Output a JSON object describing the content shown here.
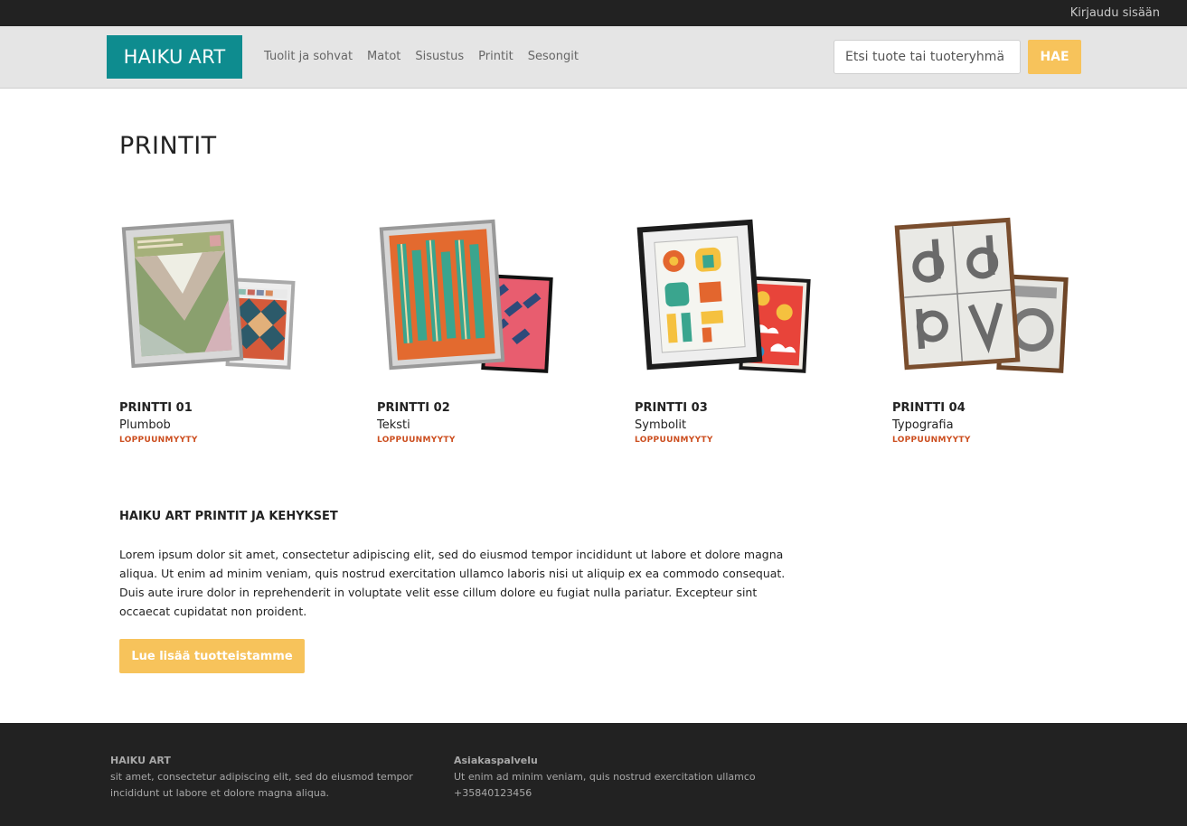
{
  "topbar": {
    "login": "Kirjaudu sisään"
  },
  "header": {
    "logo_bold": "HAIKU",
    "logo_light": "ART",
    "nav": [
      "Tuolit ja sohvat",
      "Matot",
      "Sisustus",
      "Printit",
      "Sesongit"
    ],
    "search_placeholder": "Etsi tuote tai tuoteryhmä",
    "search_button": "HAE"
  },
  "main": {
    "title": "PRINTIT",
    "products": [
      {
        "name": "PRINTTI 01",
        "subtitle": "Plumbob",
        "status": "LOPPUUNMYYTY",
        "frame_color": "#c9c9c9"
      },
      {
        "name": "PRINTTI 02",
        "subtitle": "Teksti",
        "status": "LOPPUUNMYYTY",
        "frame_color": "#c9c9c9"
      },
      {
        "name": "PRINTTI 03",
        "subtitle": "Symbolit",
        "status": "LOPPUUNMYYTY",
        "frame_color": "#222222"
      },
      {
        "name": "PRINTTI 04",
        "subtitle": "Typografia",
        "status": "LOPPUUNMYYTY",
        "frame_color": "#7a4e2e"
      }
    ],
    "section_heading": "HAIKU ART PRINTIT JA KEHYKSET",
    "section_body": "Lorem ipsum dolor sit amet, consectetur adipiscing elit, sed do eiusmod tempor incididunt ut labore et dolore magna aliqua. Ut enim ad minim veniam, quis nostrud exercitation ullamco laboris nisi ut aliquip ex ea commodo consequat. Duis aute irure dolor in reprehenderit in voluptate velit esse cillum dolore eu fugiat nulla pariatur. Excepteur sint occaecat cupidatat non proident.",
    "read_more": "Lue lisää tuotteistamme"
  },
  "footer": {
    "col1_title": "HAIKU ART",
    "col1_line1": "sit amet, consectetur adipiscing elit, sed do eiusmod tempor",
    "col1_line2": "incididunt ut labore et dolore magna aliqua.",
    "col2_title": "Asiakaspalvelu",
    "col2_line1": "Ut enim ad minim veniam, quis nostrud exercitation ullamco",
    "col2_line2": "+35840123456"
  },
  "colors": {
    "accent": "#f7c35b",
    "brand": "#0e8c8f",
    "status": "#cc4e1f",
    "dark": "#222222"
  }
}
